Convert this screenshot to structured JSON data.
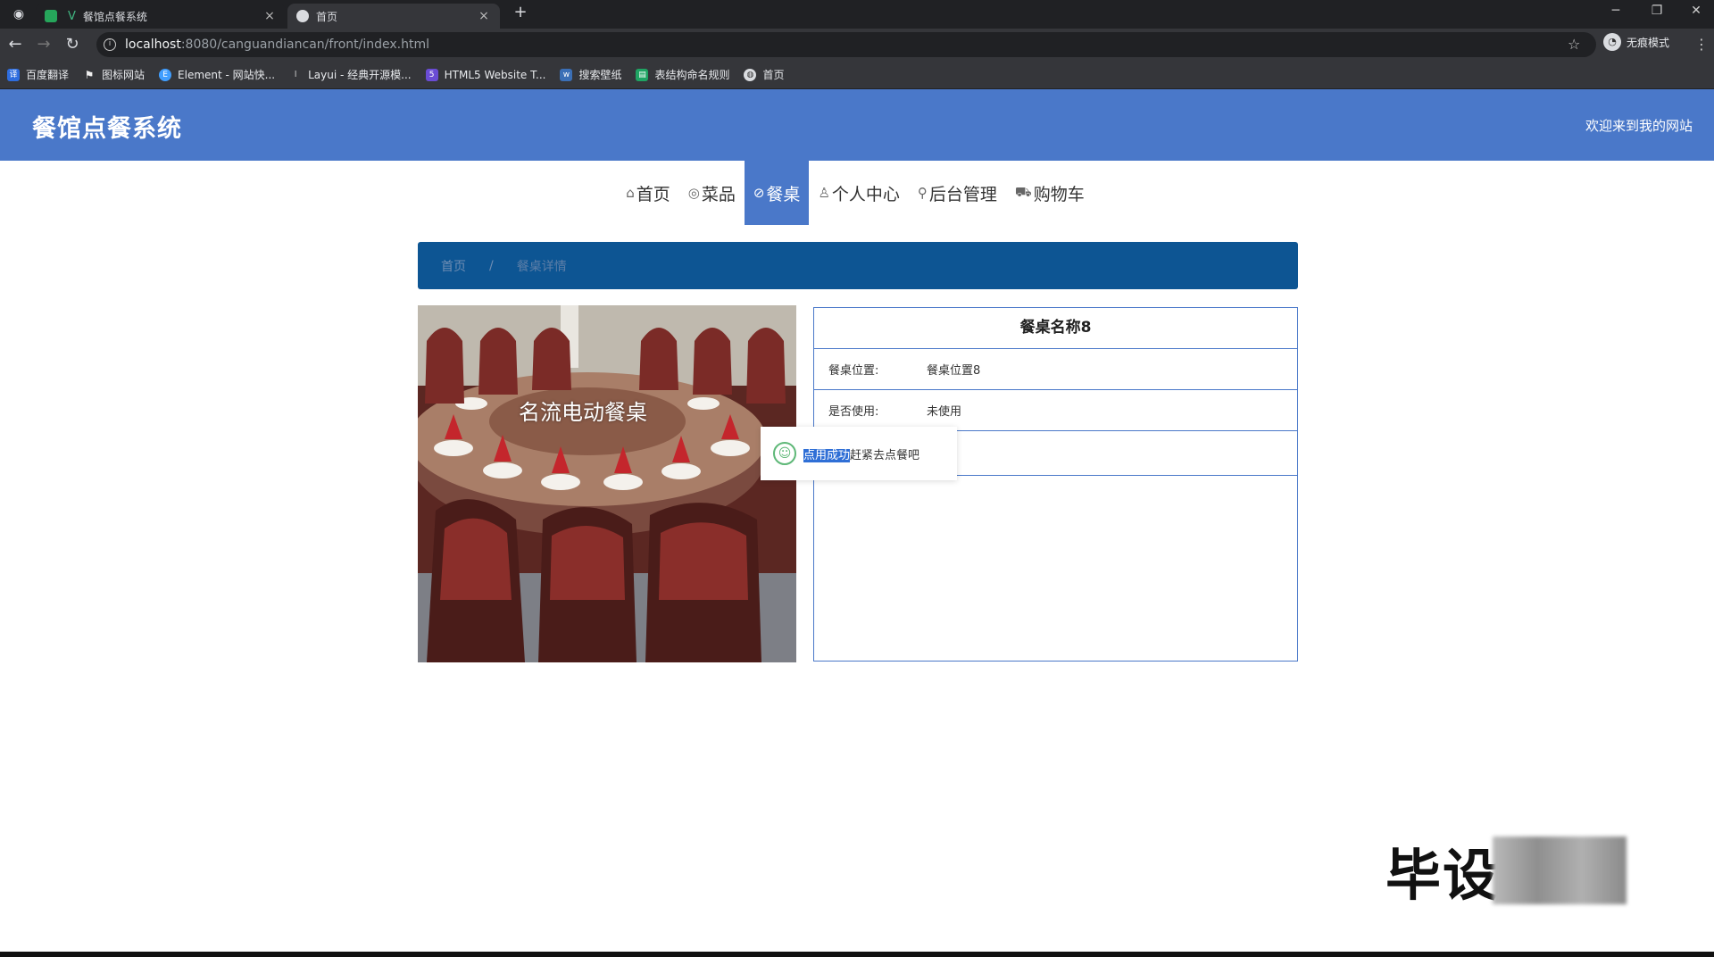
{
  "browser": {
    "tabs": [
      {
        "title": "餐馆点餐系统",
        "active": false
      },
      {
        "title": "首页",
        "active": true
      }
    ],
    "new_tab": "+",
    "url_host": "localhost",
    "url_rest": ":8080/canguandiancan/front/index.html",
    "profile_label": "无痕模式",
    "bookmarks": [
      {
        "label": "百度翻译",
        "icon": "translate-icon"
      },
      {
        "label": "图标网站",
        "icon": "flag-icon"
      },
      {
        "label": "Element - 网站快...",
        "icon": "element-icon"
      },
      {
        "label": "Layui - 经典开源模...",
        "icon": "layui-icon"
      },
      {
        "label": "HTML5 Website T...",
        "icon": "html5-icon"
      },
      {
        "label": "搜索壁纸",
        "icon": "wallpaper-icon"
      },
      {
        "label": "表结构命名规则",
        "icon": "table-icon"
      },
      {
        "label": "首页",
        "icon": "globe-icon"
      }
    ]
  },
  "site": {
    "title": "餐馆点餐系统",
    "welcome": "欢迎来到我的网站",
    "nav": [
      {
        "label": "首页",
        "icon": "home-icon",
        "active": false
      },
      {
        "label": "菜品",
        "icon": "dish-icon",
        "active": false
      },
      {
        "label": "餐桌",
        "icon": "table-icon",
        "active": true
      },
      {
        "label": "个人中心",
        "icon": "user-icon",
        "active": false
      },
      {
        "label": "后台管理",
        "icon": "link-icon",
        "active": false
      },
      {
        "label": "购物车",
        "icon": "cart-icon",
        "active": false
      }
    ],
    "breadcrumb": {
      "home": "首页",
      "separator": "/",
      "current": "餐桌详情"
    }
  },
  "detail": {
    "photo_caption": "名流电动餐桌",
    "name": "餐桌名称8",
    "rows": [
      {
        "label": "餐桌位置:",
        "value": "餐桌位置8"
      },
      {
        "label": "是否使用:",
        "value": "未使用"
      }
    ]
  },
  "toast": {
    "selected_text": "点用成功",
    "rest_text": "赶紧去点餐吧"
  },
  "watermark": {
    "text": "毕设"
  },
  "colors": {
    "header_blue": "#4a78c9",
    "breadcrumb_blue": "#0d5593",
    "success_green": "#5fb878"
  }
}
